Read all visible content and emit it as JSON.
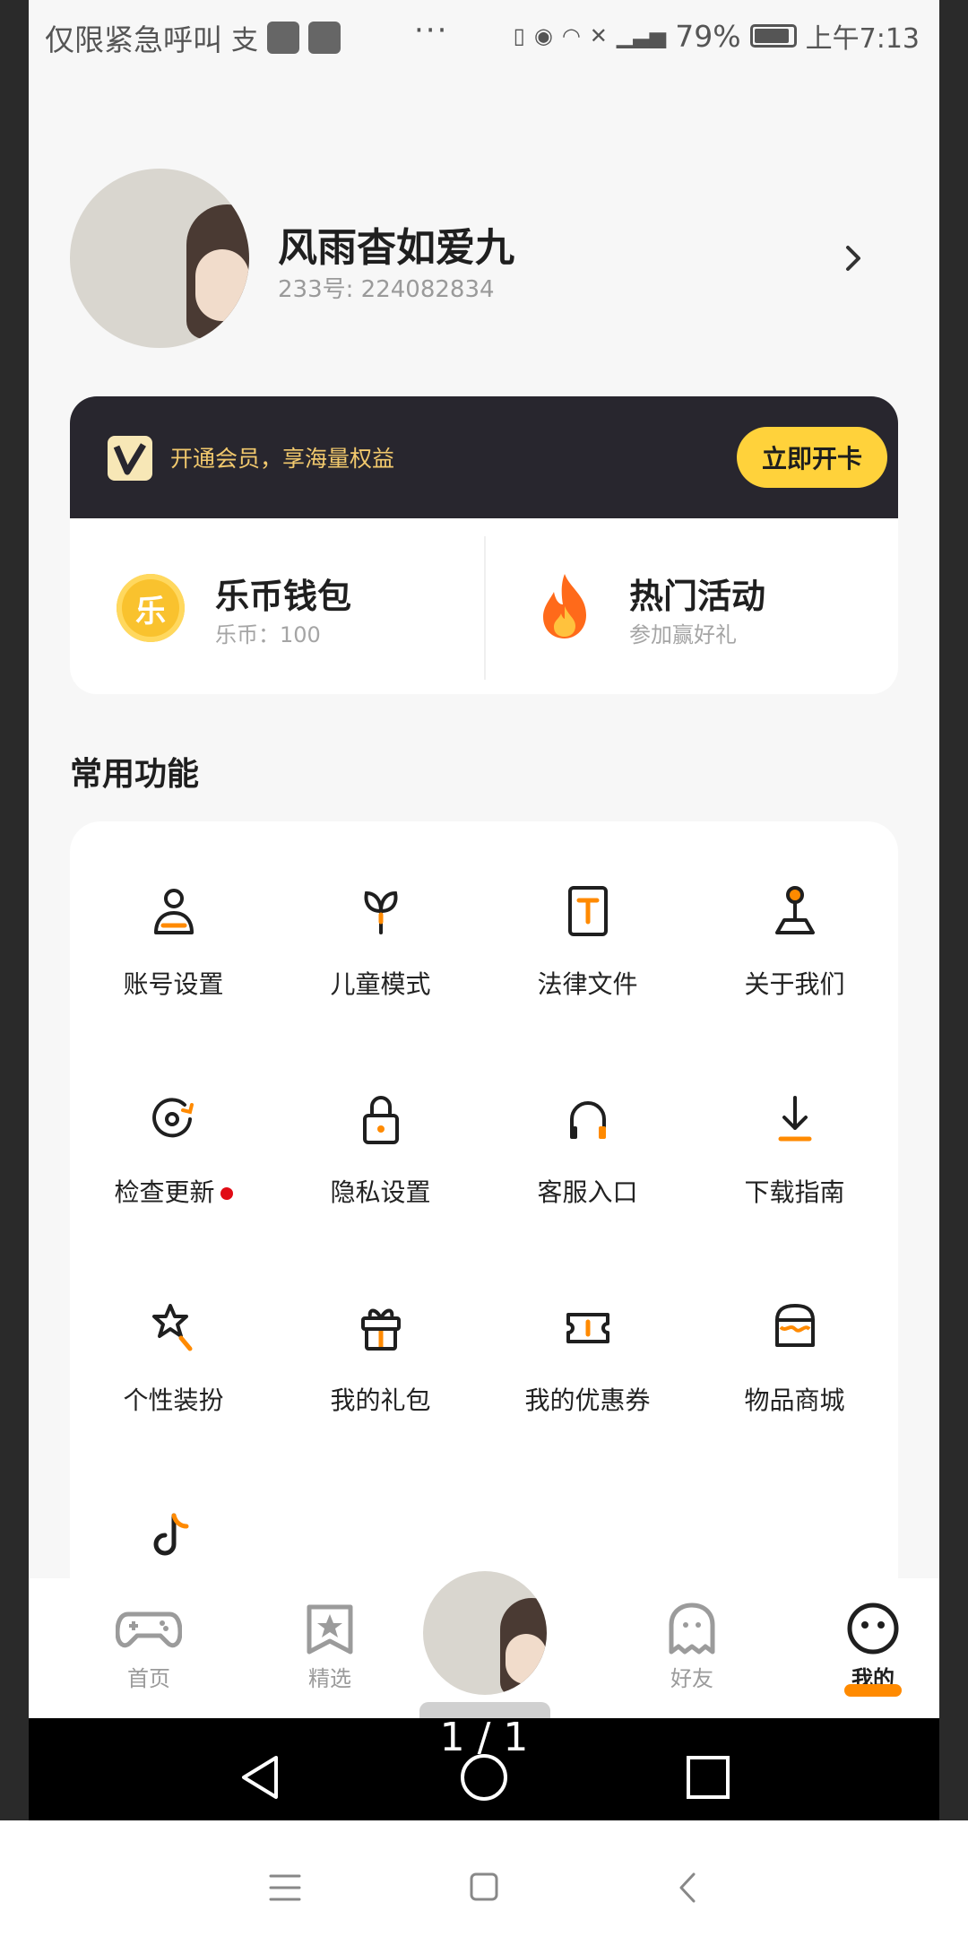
{
  "status_bar": {
    "left_text": "仅限紧急呼叫",
    "battery": "79%",
    "time": "上午7:13"
  },
  "profile": {
    "name": "风雨杳如爱九",
    "uid": "233号: 224082834"
  },
  "vip": {
    "text": "开通会员，享海量权益",
    "button": "立即开卡"
  },
  "wallet": {
    "title": "乐币钱包",
    "subtitle": "乐币：100",
    "coin_char": "乐"
  },
  "activity": {
    "title": "热门活动",
    "subtitle": "参加赢好礼"
  },
  "section_title": "常用功能",
  "features": [
    {
      "label": "账号设置",
      "icon": "user-icon"
    },
    {
      "label": "儿童模式",
      "icon": "sprout-icon"
    },
    {
      "label": "法律文件",
      "icon": "document-icon"
    },
    {
      "label": "关于我们",
      "icon": "joystick-icon"
    },
    {
      "label": "检查更新",
      "icon": "refresh-icon"
    },
    {
      "label": "隐私设置",
      "icon": "lock-icon"
    },
    {
      "label": "客服入口",
      "icon": "headphones-icon"
    },
    {
      "label": "下载指南",
      "icon": "download-icon"
    },
    {
      "label": "个性装扮",
      "icon": "magic-icon"
    },
    {
      "label": "我的礼包",
      "icon": "gift-icon"
    },
    {
      "label": "我的优惠券",
      "icon": "ticket-icon"
    },
    {
      "label": "物品商城",
      "icon": "store-icon"
    },
    {
      "label": "",
      "icon": "music-icon"
    }
  ],
  "bottom_nav": [
    {
      "label": "首页",
      "icon": "gamepad-icon"
    },
    {
      "label": "精选",
      "icon": "star-bookmark-icon"
    },
    {
      "label": "好友",
      "icon": "ghost-icon"
    },
    {
      "label": "我的",
      "icon": "smile-icon"
    }
  ],
  "page_indicator": "1 / 1",
  "colors": {
    "accent": "#ff8a00",
    "vip_bg": "#28262e",
    "vip_button": "#ffd23b",
    "red_dot": "#e10b15"
  }
}
